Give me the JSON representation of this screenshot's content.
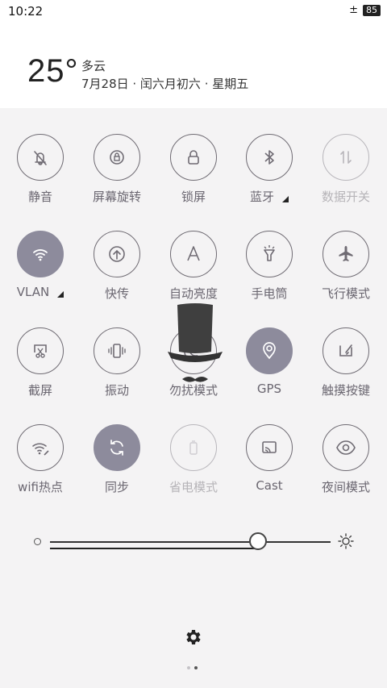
{
  "status_bar": {
    "time": "10:22",
    "data_icon": "±",
    "battery": "85"
  },
  "header": {
    "temperature": "25°",
    "weather": "多云",
    "date": "7月28日 · 闰六月初六 · 星期五"
  },
  "tiles": [
    {
      "label": "静音",
      "icon": "bell-off-icon",
      "state": "off"
    },
    {
      "label": "屏幕旋转",
      "icon": "rotation-lock-icon",
      "state": "off"
    },
    {
      "label": "锁屏",
      "icon": "lock-icon",
      "state": "off"
    },
    {
      "label": "蓝牙",
      "icon": "bluetooth-icon",
      "state": "off",
      "expand": true
    },
    {
      "label": "数据开关",
      "icon": "mobile-data-icon",
      "state": "disabled"
    },
    {
      "label": "VLAN",
      "icon": "wifi-icon",
      "state": "on",
      "expand": true
    },
    {
      "label": "快传",
      "icon": "upload-circle-icon",
      "state": "off"
    },
    {
      "label": "自动亮度",
      "icon": "auto-brightness-icon",
      "state": "off"
    },
    {
      "label": "手电筒",
      "icon": "flashlight-icon",
      "state": "off"
    },
    {
      "label": "飞行模式",
      "icon": "airplane-icon",
      "state": "off"
    },
    {
      "label": "截屏",
      "icon": "screenshot-icon",
      "state": "off"
    },
    {
      "label": "振动",
      "icon": "vibrate-icon",
      "state": "off"
    },
    {
      "label": "勿扰模式",
      "icon": "moon-icon",
      "state": "off"
    },
    {
      "label": "GPS",
      "icon": "gps-icon",
      "state": "on"
    },
    {
      "label": "触摸按键",
      "icon": "touch-key-icon",
      "state": "off"
    },
    {
      "label": "wifi热点",
      "icon": "hotspot-icon",
      "state": "off"
    },
    {
      "label": "同步",
      "icon": "sync-icon",
      "state": "on"
    },
    {
      "label": "省电模式",
      "icon": "battery-saver-icon",
      "state": "disabled"
    },
    {
      "label": "Cast",
      "icon": "cast-icon",
      "state": "off"
    },
    {
      "label": "夜间模式",
      "icon": "eye-icon",
      "state": "off"
    }
  ],
  "brightness": {
    "level": 0.74
  },
  "pager": {
    "pages": 2,
    "current": 2
  }
}
